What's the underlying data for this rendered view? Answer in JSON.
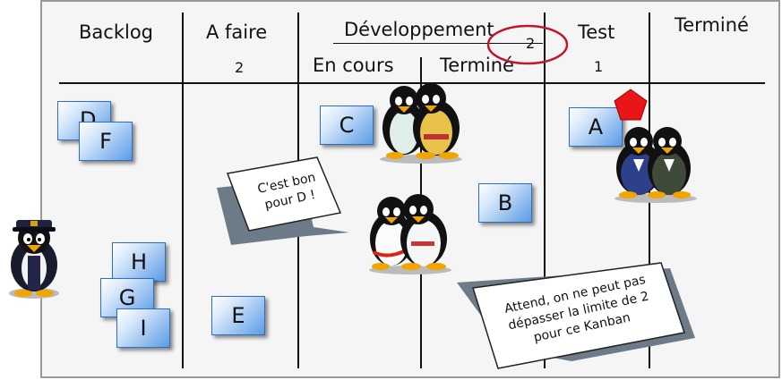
{
  "board": {
    "columns": {
      "backlog": "Backlog",
      "todo": "A faire",
      "dev": "Développement",
      "dev_in_progress": "En cours",
      "dev_done": "Terminé",
      "test": "Test",
      "done": "Terminé"
    },
    "limits": {
      "todo": "2",
      "dev": "2",
      "test": "1"
    }
  },
  "cards": {
    "d": "D",
    "f": "F",
    "h": "H",
    "g": "G",
    "i": "I",
    "e": "E",
    "c": "C",
    "b": "B",
    "a": "A"
  },
  "bubbles": {
    "left_line1": "C'est bon",
    "left_line2": "pour D !",
    "right_line1": "Attend, on ne peut pas",
    "right_line2": "dépasser la limite de 2",
    "right_line3": "pour ce Kanban"
  },
  "colors": {
    "limit_circle": "#c0152a",
    "card_blue": "#5a9be6",
    "alert_shape": "#e81616"
  },
  "icons": [
    "penguin-pilot-icon",
    "penguin-pair-icon",
    "red-pentagon-icon"
  ]
}
